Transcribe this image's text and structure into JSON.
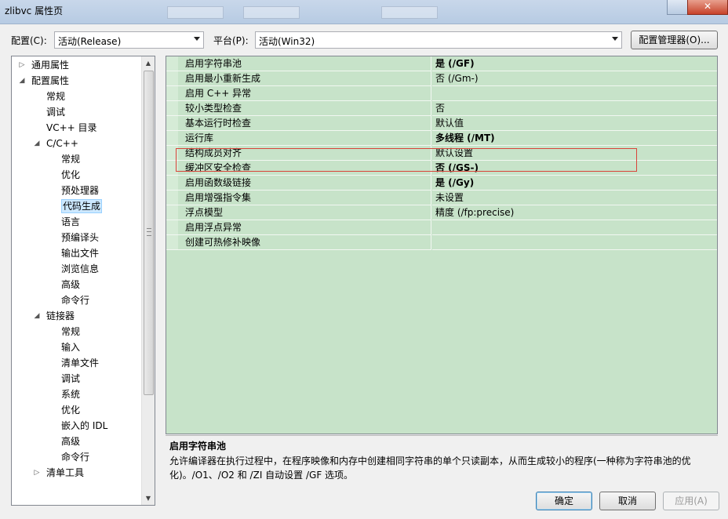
{
  "window": {
    "title": "zlibvc 属性页",
    "close_label": "✕"
  },
  "toolbar": {
    "config_label": "配置(C):",
    "config_value": "活动(Release)",
    "platform_label": "平台(P):",
    "platform_value": "活动(Win32)",
    "config_manager_label": "配置管理器(O)..."
  },
  "tree": {
    "items": [
      {
        "label": "通用属性",
        "expander": "▷"
      },
      {
        "label": "配置属性",
        "expander": "◢"
      },
      {
        "label": "常规"
      },
      {
        "label": "调试"
      },
      {
        "label": "VC++ 目录"
      },
      {
        "label": "C/C++",
        "expander": "◢"
      },
      {
        "label": "常规"
      },
      {
        "label": "优化"
      },
      {
        "label": "预处理器"
      },
      {
        "label": "代码生成"
      },
      {
        "label": "语言"
      },
      {
        "label": "预编译头"
      },
      {
        "label": "输出文件"
      },
      {
        "label": "浏览信息"
      },
      {
        "label": "高级"
      },
      {
        "label": "命令行"
      },
      {
        "label": "链接器",
        "expander": "◢"
      },
      {
        "label": "常规"
      },
      {
        "label": "输入"
      },
      {
        "label": "清单文件"
      },
      {
        "label": "调试"
      },
      {
        "label": "系统"
      },
      {
        "label": "优化"
      },
      {
        "label": "嵌入的 IDL"
      },
      {
        "label": "高级"
      },
      {
        "label": "命令行"
      },
      {
        "label": "清单工具",
        "expander": "▷"
      }
    ],
    "selected_label": "代码生成"
  },
  "properties": [
    {
      "name": "启用字符串池",
      "value": "是 (/GF)",
      "bold": true
    },
    {
      "name": "启用最小重新生成",
      "value": "否 (/Gm-)",
      "bold": false
    },
    {
      "name": "启用 C++ 异常",
      "value": "",
      "bold": false
    },
    {
      "name": "较小类型检查",
      "value": "否",
      "bold": false
    },
    {
      "name": "基本运行时检查",
      "value": "默认值",
      "bold": false
    },
    {
      "name": "运行库",
      "value": "多线程 (/MT)",
      "bold": true
    },
    {
      "name": "结构成员对齐",
      "value": "默认设置",
      "bold": false
    },
    {
      "name": "缓冲区安全检查",
      "value": "否 (/GS-)",
      "bold": true
    },
    {
      "name": "启用函数级链接",
      "value": "是 (/Gy)",
      "bold": true
    },
    {
      "name": "启用增强指令集",
      "value": "未设置",
      "bold": false
    },
    {
      "name": "浮点模型",
      "value": "精度 (/fp:precise)",
      "bold": false
    },
    {
      "name": "启用浮点异常",
      "value": "",
      "bold": false
    },
    {
      "name": "创建可热修补映像",
      "value": "",
      "bold": false
    }
  ],
  "description": {
    "title": "启用字符串池",
    "text": "允许编译器在执行过程中，在程序映像和内存中创建相同字符串的单个只读副本，从而生成较小的程序(一种称为字符串池的优化)。/O1、/O2 和 /ZI 自动设置 /GF 选项。"
  },
  "buttons": {
    "ok": "确定",
    "cancel": "取消",
    "apply": "应用(A)"
  }
}
